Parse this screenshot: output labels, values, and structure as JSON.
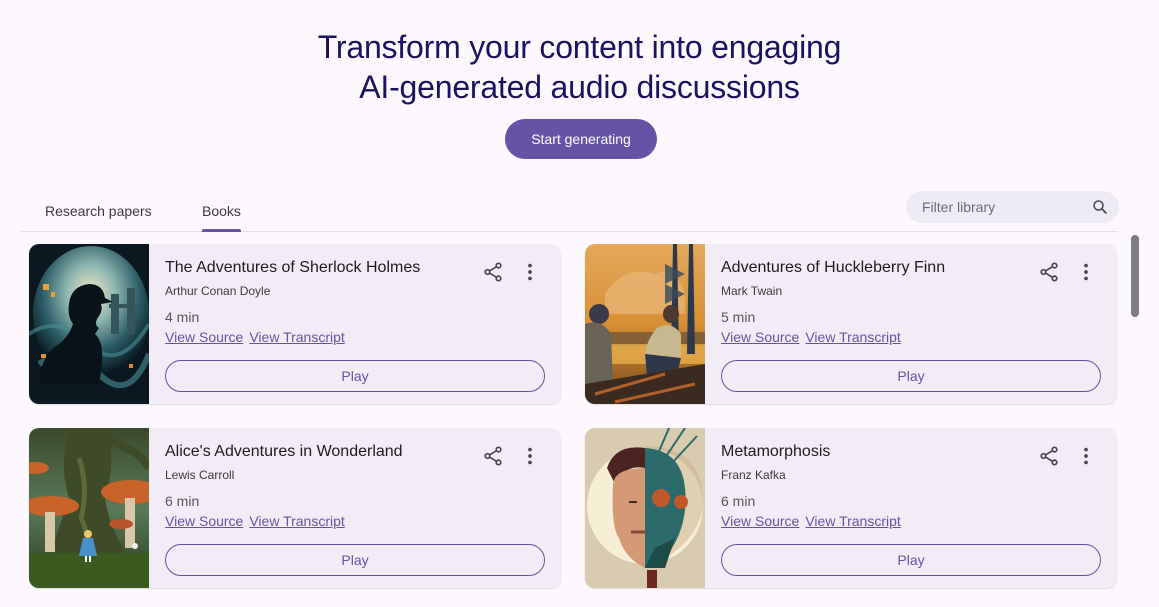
{
  "hero": {
    "title_line1": "Transform your content into engaging",
    "title_line2": "AI-generated audio discussions",
    "cta_label": "Start generating"
  },
  "tabs": [
    {
      "label": "Research papers",
      "active": false
    },
    {
      "label": "Books",
      "active": true
    }
  ],
  "search": {
    "placeholder": "Filter library",
    "value": "",
    "icon": "search-icon"
  },
  "colors": {
    "accent": "#6554a5",
    "title": "#1b1360",
    "card_bg": "#f1ecf5",
    "page_bg": "#fdf8fd"
  },
  "books": [
    {
      "title": "The Adventures of Sherlock Holmes",
      "author": "Arthur Conan Doyle",
      "duration": "4 min",
      "view_source": "View Source",
      "view_transcript": "View Transcript",
      "play_label": "Play",
      "cover": "silhouette-detective-with-pipe-swirling-fog-london"
    },
    {
      "title": "Adventures of Huckleberry Finn",
      "author": "Mark Twain",
      "duration": "5 min",
      "view_source": "View Source",
      "view_transcript": "View Transcript",
      "play_label": "Play",
      "cover": "two-boys-sitting-by-river-sunset-pine-trees"
    },
    {
      "title": "Alice's Adventures in Wonderland",
      "author": "Lewis Carroll",
      "duration": "6 min",
      "view_source": "View Source",
      "view_transcript": "View Transcript",
      "play_label": "Play",
      "cover": "girl-in-blue-dress-giant-tree-mushrooms"
    },
    {
      "title": "Metamorphosis",
      "author": "Franz Kafka",
      "duration": "6 min",
      "view_source": "View Source",
      "view_transcript": "View Transcript",
      "play_label": "Play",
      "cover": "half-man-half-insect-face"
    }
  ]
}
